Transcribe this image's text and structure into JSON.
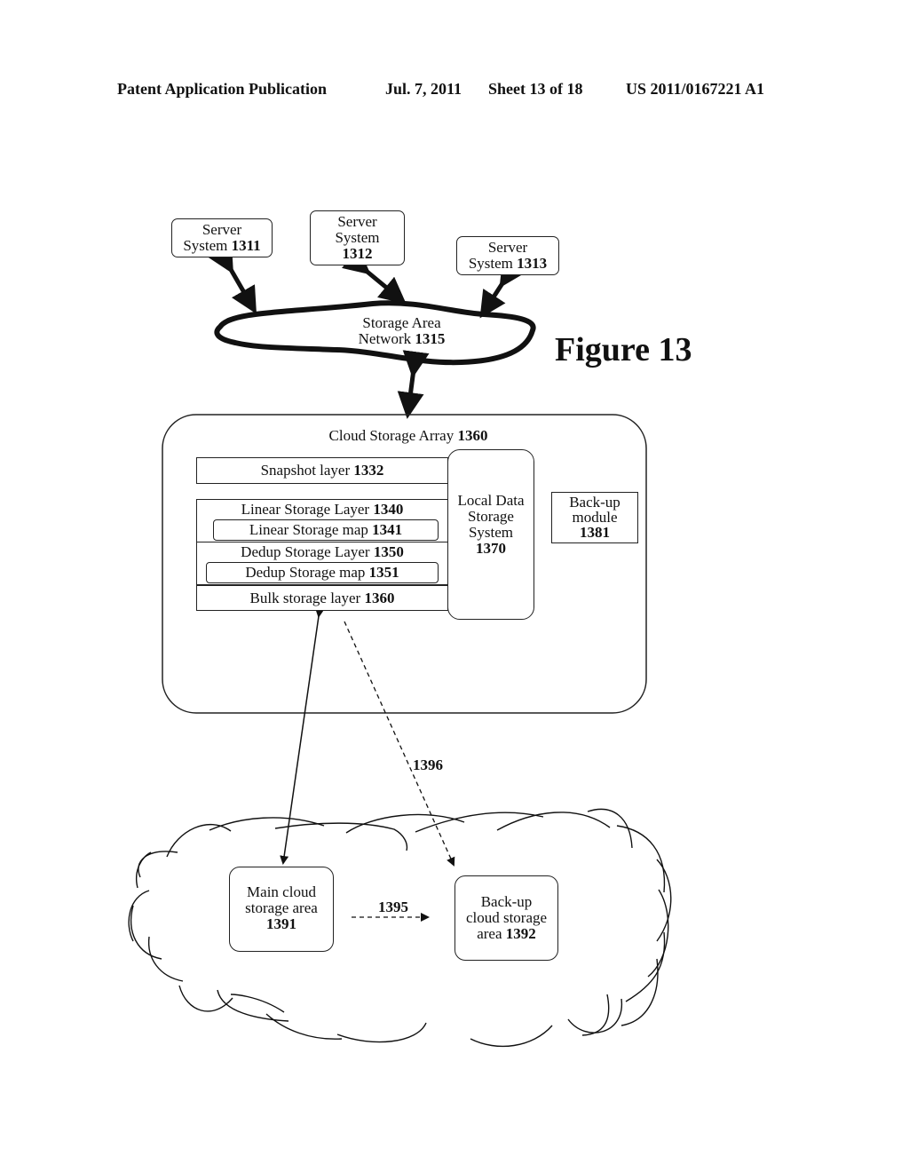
{
  "header": {
    "publication": "Patent Application Publication",
    "date": "Jul. 7, 2011",
    "sheet": "Sheet 13 of 18",
    "number": "US 2011/0167221 A1"
  },
  "figure_title": "Figure 13",
  "servers": [
    {
      "line1": "Server",
      "line2": "System",
      "id": "1311"
    },
    {
      "line1": "Server",
      "line2": "System",
      "id": "1312"
    },
    {
      "line1": "Server",
      "line2": "System",
      "id": "1313"
    }
  ],
  "san": {
    "line1": "Storage Area",
    "line2": "Network",
    "id": "1315"
  },
  "cloud_array": {
    "label": "Cloud Storage Array",
    "id": "1360"
  },
  "layers": {
    "snapshot": {
      "label": "Snapshot layer",
      "id": "1332"
    },
    "linear_layer": {
      "label": "Linear Storage Layer",
      "id": "1340"
    },
    "linear_map": {
      "label": "Linear Storage map",
      "id": "1341"
    },
    "dedup_layer": {
      "label": "Dedup Storage Layer",
      "id": "1350"
    },
    "dedup_map": {
      "label": "Dedup Storage map",
      "id": "1351"
    },
    "bulk": {
      "label": "Bulk storage layer",
      "id": "1360"
    }
  },
  "local_storage": {
    "line1": "Local Data",
    "line2": "Storage",
    "line3": "System",
    "id": "1370"
  },
  "backup_module": {
    "line1": "Back-up",
    "line2": "module",
    "id": "1381"
  },
  "main_cloud": {
    "line1": "Main cloud",
    "line2": "storage area",
    "id": "1391"
  },
  "backup_cloud": {
    "line1": "Back-up",
    "line2": "cloud storage",
    "line3": "area",
    "id": "1392"
  },
  "connections": {
    "replication": "1395",
    "backup_path": "1396"
  }
}
